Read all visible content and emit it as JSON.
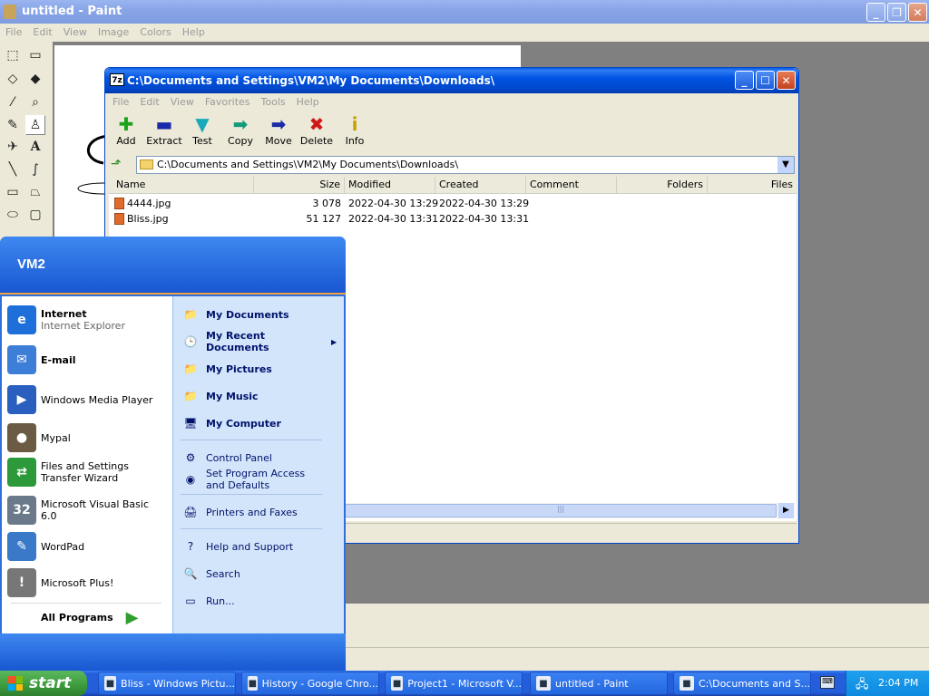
{
  "paint": {
    "title": "untitled - Paint",
    "menu": [
      "File",
      "Edit",
      "View",
      "Image",
      "Colors",
      "Help"
    ]
  },
  "zip": {
    "title": "C:\\Documents and Settings\\VM2\\My Documents\\Downloads\\",
    "menu": [
      "File",
      "Edit",
      "View",
      "Favorites",
      "Tools",
      "Help"
    ],
    "toolbar": [
      {
        "label": "Add",
        "icon": "plus-icon",
        "glyph": "✚",
        "color": "#1aa31a"
      },
      {
        "label": "Extract",
        "icon": "minus-icon",
        "glyph": "▬",
        "color": "#1a2aa8"
      },
      {
        "label": "Test",
        "icon": "check-icon",
        "glyph": "▼",
        "color": "#1aa9b8"
      },
      {
        "label": "Copy",
        "icon": "copy-arrow-icon",
        "glyph": "➡",
        "color": "#159a7a"
      },
      {
        "label": "Move",
        "icon": "move-arrow-icon",
        "glyph": "➡",
        "color": "#1a2aa8"
      },
      {
        "label": "Delete",
        "icon": "delete-icon",
        "glyph": "✖",
        "color": "#d01818"
      },
      {
        "label": "Info",
        "icon": "info-icon",
        "glyph": "i",
        "color": "#c8a000"
      }
    ],
    "address": "C:\\Documents and Settings\\VM2\\My Documents\\Downloads\\",
    "columns": [
      "Name",
      "Size",
      "Modified",
      "Created",
      "Comment",
      "Folders",
      "Files"
    ],
    "files": [
      {
        "name": "4444.jpg",
        "size": "3 078",
        "modified": "2022-04-30 13:29",
        "created": "2022-04-30 13:29"
      },
      {
        "name": "Bliss.jpg",
        "size": "51 127",
        "modified": "2022-04-30 13:31",
        "created": "2022-04-30 13:31"
      }
    ]
  },
  "start_menu": {
    "user": "VM2",
    "left_items": [
      {
        "title": "Internet",
        "sub": "Internet Explorer",
        "icon": "internet-explorer-icon",
        "glyph": "e",
        "color": "#1e6fd9",
        "bold": true
      },
      {
        "title": "E-mail",
        "sub": "",
        "icon": "email-icon",
        "glyph": "✉",
        "color": "#3d7ed8",
        "bold": true
      },
      {
        "title": "Windows Media Player",
        "sub": "",
        "icon": "media-player-icon",
        "glyph": "▶",
        "color": "#2a5fc0",
        "bold": false
      },
      {
        "title": "Mypal",
        "sub": "",
        "icon": "mypal-icon",
        "glyph": "●",
        "color": "#6b5a44",
        "bold": false
      },
      {
        "title": "Files and Settings Transfer Wizard",
        "sub": "",
        "icon": "transfer-wizard-icon",
        "glyph": "⇄",
        "color": "#2c9a3a",
        "bold": false
      },
      {
        "title": "Microsoft Visual Basic 6.0",
        "sub": "",
        "icon": "visual-basic-icon",
        "glyph": "32",
        "color": "#6a7a8a",
        "bold": false
      },
      {
        "title": "WordPad",
        "sub": "",
        "icon": "wordpad-icon",
        "glyph": "✎",
        "color": "#3a78c8",
        "bold": false
      },
      {
        "title": "Microsoft Plus!",
        "sub": "",
        "icon": "microsoft-plus-icon",
        "glyph": "!",
        "color": "#777777",
        "bold": false
      }
    ],
    "all_programs": "All Programs",
    "right_items": [
      {
        "title": "My Documents",
        "icon": "my-documents-icon",
        "glyph": "📁",
        "bold": true
      },
      {
        "title": "My Recent Documents",
        "icon": "recent-documents-icon",
        "glyph": "🕒",
        "bold": true,
        "arrow": true
      },
      {
        "title": "My Pictures",
        "icon": "my-pictures-icon",
        "glyph": "📁",
        "bold": true
      },
      {
        "title": "My Music",
        "icon": "my-music-icon",
        "glyph": "📁",
        "bold": true
      },
      {
        "title": "My Computer",
        "icon": "my-computer-icon",
        "glyph": "🖥",
        "bold": true
      },
      {
        "title": "Control Panel",
        "icon": "control-panel-icon",
        "glyph": "⚙",
        "bold": false
      },
      {
        "title": "Set Program Access and Defaults",
        "icon": "program-access-icon",
        "glyph": "◉",
        "bold": false
      },
      {
        "title": "Printers and Faxes",
        "icon": "printer-icon",
        "glyph": "🖨",
        "bold": false
      },
      {
        "title": "Help and Support",
        "icon": "help-icon",
        "glyph": "?",
        "bold": false
      },
      {
        "title": "Search",
        "icon": "search-icon",
        "glyph": "🔍",
        "bold": false
      },
      {
        "title": "Run...",
        "icon": "run-icon",
        "glyph": "▭",
        "bold": false
      }
    ]
  },
  "taskbar": {
    "start_label": "start",
    "buttons": [
      {
        "label": "Bliss - Windows Pictu...",
        "icon": "picture-viewer-icon"
      },
      {
        "label": "History - Google Chro...",
        "icon": "chrome-icon"
      },
      {
        "label": "Project1 - Microsoft V...",
        "icon": "visual-basic-icon"
      },
      {
        "label": "untitled - Paint",
        "icon": "paint-icon"
      },
      {
        "label": "C:\\Documents and S...",
        "icon": "7zip-icon"
      }
    ],
    "clock": "2:04 PM"
  }
}
